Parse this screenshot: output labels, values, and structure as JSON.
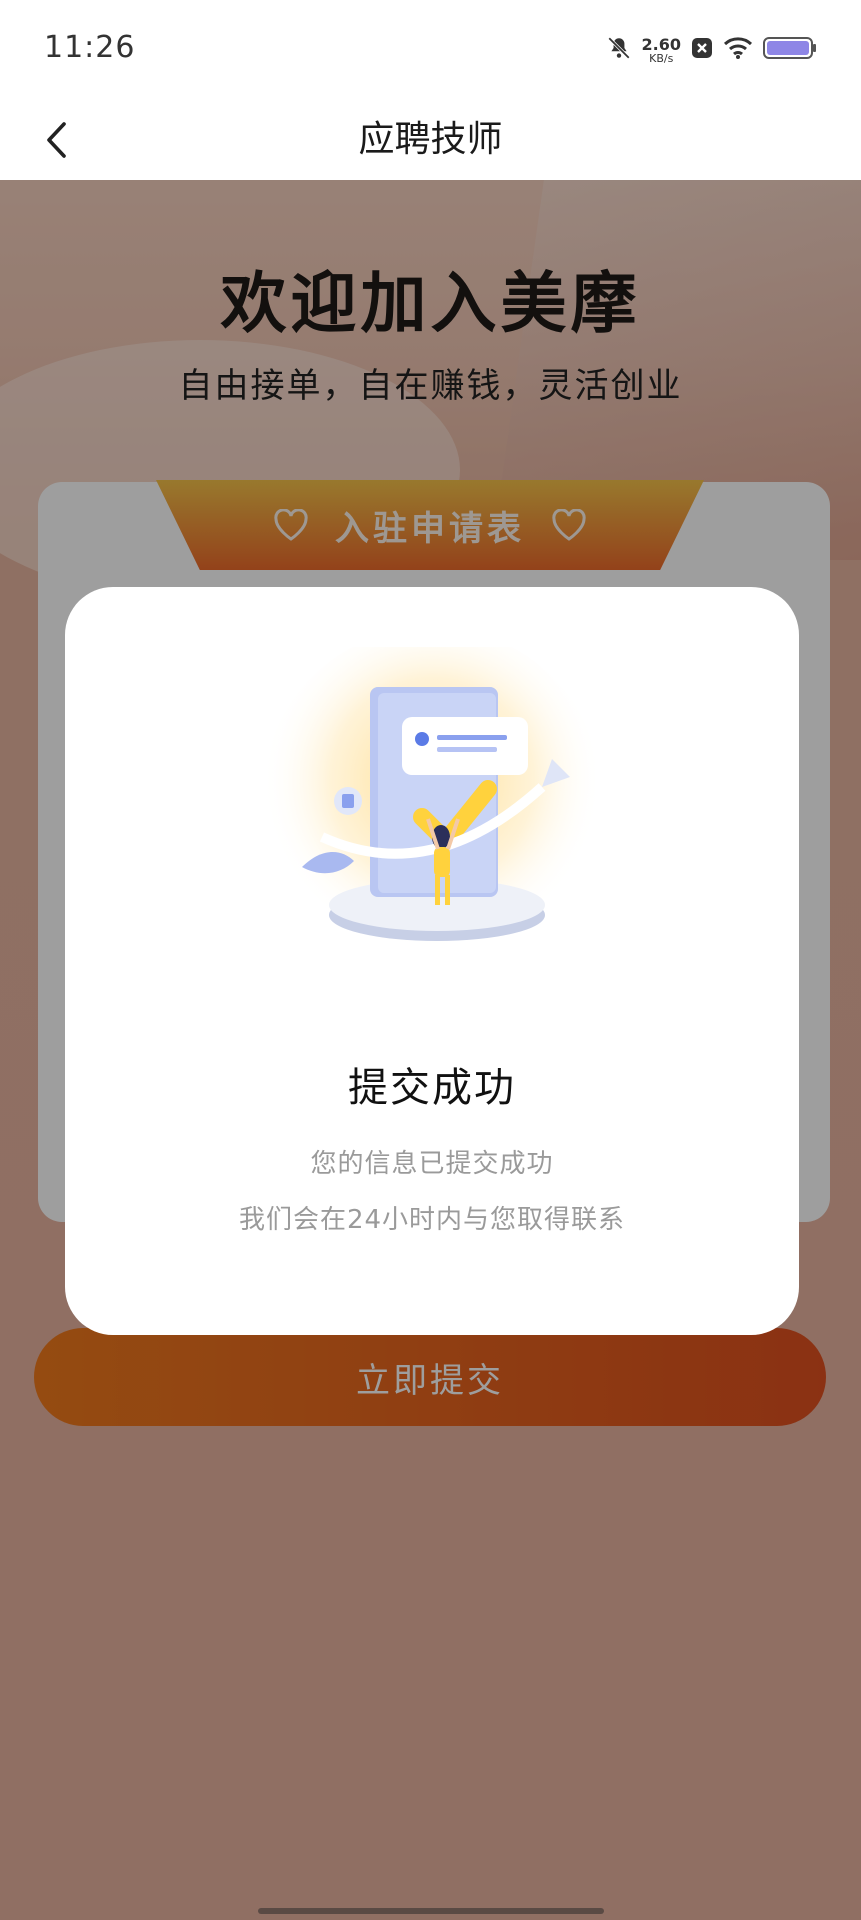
{
  "status_bar": {
    "time": "11:26",
    "net_speed_value": "2.60",
    "net_speed_unit": "KB/s",
    "icons": [
      "bell-muted-icon",
      "close-box-icon",
      "wifi-icon",
      "battery-icon"
    ]
  },
  "nav": {
    "title": "应聘技师",
    "back_icon": "chevron-left-icon"
  },
  "hero": {
    "heading": "欢迎加入美摩",
    "subheading": "自由接单，自在赚钱，灵活创业"
  },
  "form": {
    "badge_label": "入驻申请表",
    "submit_label": "立即提交"
  },
  "modal": {
    "title": "提交成功",
    "line1": "您的信息已提交成功",
    "line2": "我们会在24小时内与您取得联系",
    "illustration": "success-illustration"
  },
  "colors": {
    "accent": "#F07A1C",
    "badge_gold": "#F6C34A",
    "muted_text": "#9A9A9A"
  }
}
